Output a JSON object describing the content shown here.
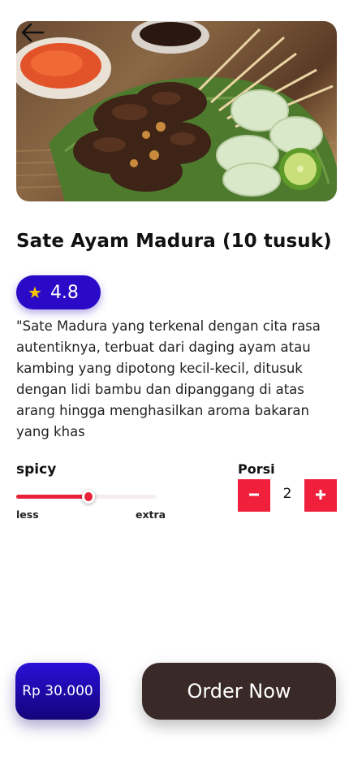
{
  "product": {
    "title": "Sate Ayam Madura (10 tusuk)",
    "rating": "4.8",
    "description": "\"Sate Madura yang terkenal dengan cita rasa autentiknya, terbuat dari daging ayam atau kambing yang dipotong kecil-kecil, ditusuk dengan lidi bambu dan dipanggang di atas arang hingga menghasilkan aroma bakaran yang khas"
  },
  "icons": {
    "back": "arrow-left-icon",
    "star": "star-icon",
    "minus": "minus-icon",
    "plus": "plus-icon"
  },
  "spicy": {
    "label": "spicy",
    "min_label": "less",
    "max_label": "extra",
    "level": 0.52
  },
  "porsi": {
    "label": "Porsi",
    "quantity": "2"
  },
  "footer": {
    "price": "Rp 30.000",
    "order_label": "Order Now"
  },
  "colors": {
    "rating_bg": "#2a0ac7",
    "accent_red": "#f01f3c",
    "order_bg": "#3a2a27",
    "price_bg": "#2a10d8"
  }
}
